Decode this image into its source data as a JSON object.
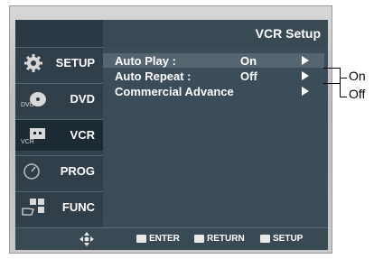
{
  "screen": {
    "title": "VCR Setup"
  },
  "sidebar": {
    "items": [
      {
        "label": "SETUP",
        "icon": "gear-icon"
      },
      {
        "label": "DVD",
        "icon": "dvd-icon",
        "icon_text": "DVD"
      },
      {
        "label": "VCR",
        "icon": "vcr-icon",
        "icon_text": "VCR",
        "active": true
      },
      {
        "label": "PROG",
        "icon": "clock-icon"
      },
      {
        "label": "FUNC",
        "icon": "hand-icon"
      }
    ]
  },
  "menu": {
    "rows": [
      {
        "label": "Auto Play :",
        "value": "On",
        "selected": true
      },
      {
        "label": "Auto Repeat :",
        "value": "Off"
      },
      {
        "label": "Commercial Advance",
        "value": ""
      }
    ]
  },
  "footer": {
    "enter": "ENTER",
    "return": "RETURN",
    "setup": "SETUP"
  },
  "callout": {
    "on": "On",
    "off": "Off"
  },
  "colors": {
    "screen_bg": "#33434e",
    "selected_row": "#556671",
    "text": "#ffffff"
  }
}
